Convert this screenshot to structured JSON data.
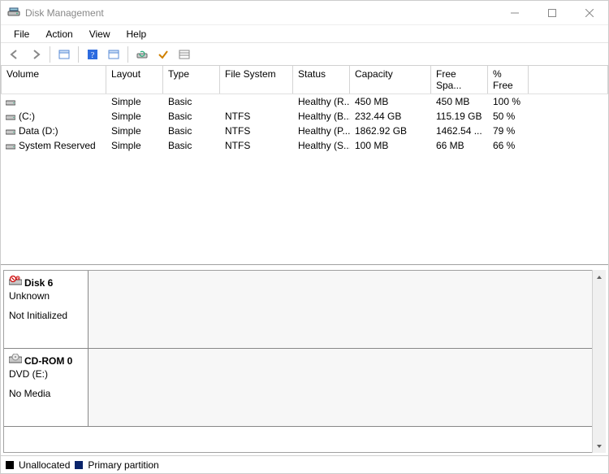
{
  "window": {
    "title": "Disk Management"
  },
  "menu": {
    "file": "File",
    "action": "Action",
    "view": "View",
    "help": "Help"
  },
  "columns": {
    "volume": "Volume",
    "layout": "Layout",
    "type": "Type",
    "filesystem": "File System",
    "status": "Status",
    "capacity": "Capacity",
    "freespace": "Free Spa...",
    "pctfree": "% Free"
  },
  "volumes": [
    {
      "name": "",
      "layout": "Simple",
      "type": "Basic",
      "fs": "",
      "status": "Healthy (R...",
      "capacity": "450 MB",
      "free": "450 MB",
      "pct": "100 %"
    },
    {
      "name": "(C:)",
      "layout": "Simple",
      "type": "Basic",
      "fs": "NTFS",
      "status": "Healthy (B...",
      "capacity": "232.44 GB",
      "free": "115.19 GB",
      "pct": "50 %"
    },
    {
      "name": "Data (D:)",
      "layout": "Simple",
      "type": "Basic",
      "fs": "NTFS",
      "status": "Healthy (P...",
      "capacity": "1862.92 GB",
      "free": "1462.54 ...",
      "pct": "79 %"
    },
    {
      "name": "System Reserved",
      "layout": "Simple",
      "type": "Basic",
      "fs": "NTFS",
      "status": "Healthy (S...",
      "capacity": "100 MB",
      "free": "66 MB",
      "pct": "66 %"
    }
  ],
  "disks": [
    {
      "icon": "unknown",
      "title": "Disk 6",
      "sub": "Unknown",
      "status": "Not Initialized"
    },
    {
      "icon": "cdrom",
      "title": "CD-ROM 0",
      "sub": "DVD (E:)",
      "status": "No Media"
    }
  ],
  "legend": {
    "unallocated": "Unallocated",
    "primary": "Primary partition"
  }
}
